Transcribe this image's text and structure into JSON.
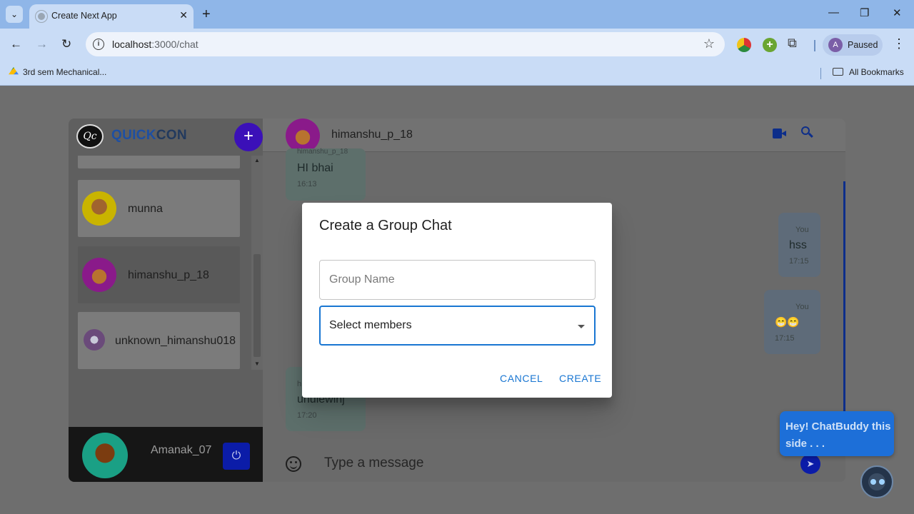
{
  "browser": {
    "tab_title": "Create Next App",
    "url_host": "localhost",
    "url_path": ":3000/chat",
    "profile_initial": "A",
    "profile_status": "Paused",
    "bookmark": "3rd sem Mechanical...",
    "all_bookmarks": "All Bookmarks"
  },
  "app": {
    "logo_text": "Qc",
    "brand_part1": "QUICK",
    "brand_part2": "CON",
    "contacts": [
      {
        "name": "munna"
      },
      {
        "name": "himanshu_p_18"
      },
      {
        "name": "unknown_himanshu018"
      }
    ],
    "current_user": "Amanak_07"
  },
  "chat": {
    "title": "himanshu_p_18",
    "messages": [
      {
        "sender": "himanshu_p_18",
        "text": "HI bhai",
        "time": "16:13",
        "direction": "in"
      },
      {
        "sender": "You",
        "text": "hss",
        "time": "17:15",
        "direction": "out"
      },
      {
        "sender": "You",
        "text": "😁😁",
        "time": "17:15",
        "direction": "out"
      },
      {
        "sender": "h",
        "text": "uhuiewinj",
        "time": "17:20",
        "direction": "in"
      }
    ],
    "input_placeholder": "Type a message"
  },
  "dialog": {
    "title": "Create a Group Chat",
    "group_name_placeholder": "Group Name",
    "members_value": "Select members",
    "cancel_label": "CANCEL",
    "create_label": "CREATE"
  },
  "buddy": {
    "text": "Hey! ChatBuddy this side . . ."
  },
  "colors": {
    "accent": "#1976d2",
    "brand_blue": "#1d4fa3",
    "add_button": "#3b10b8",
    "buddy_bubble": "#1d6fd8"
  }
}
